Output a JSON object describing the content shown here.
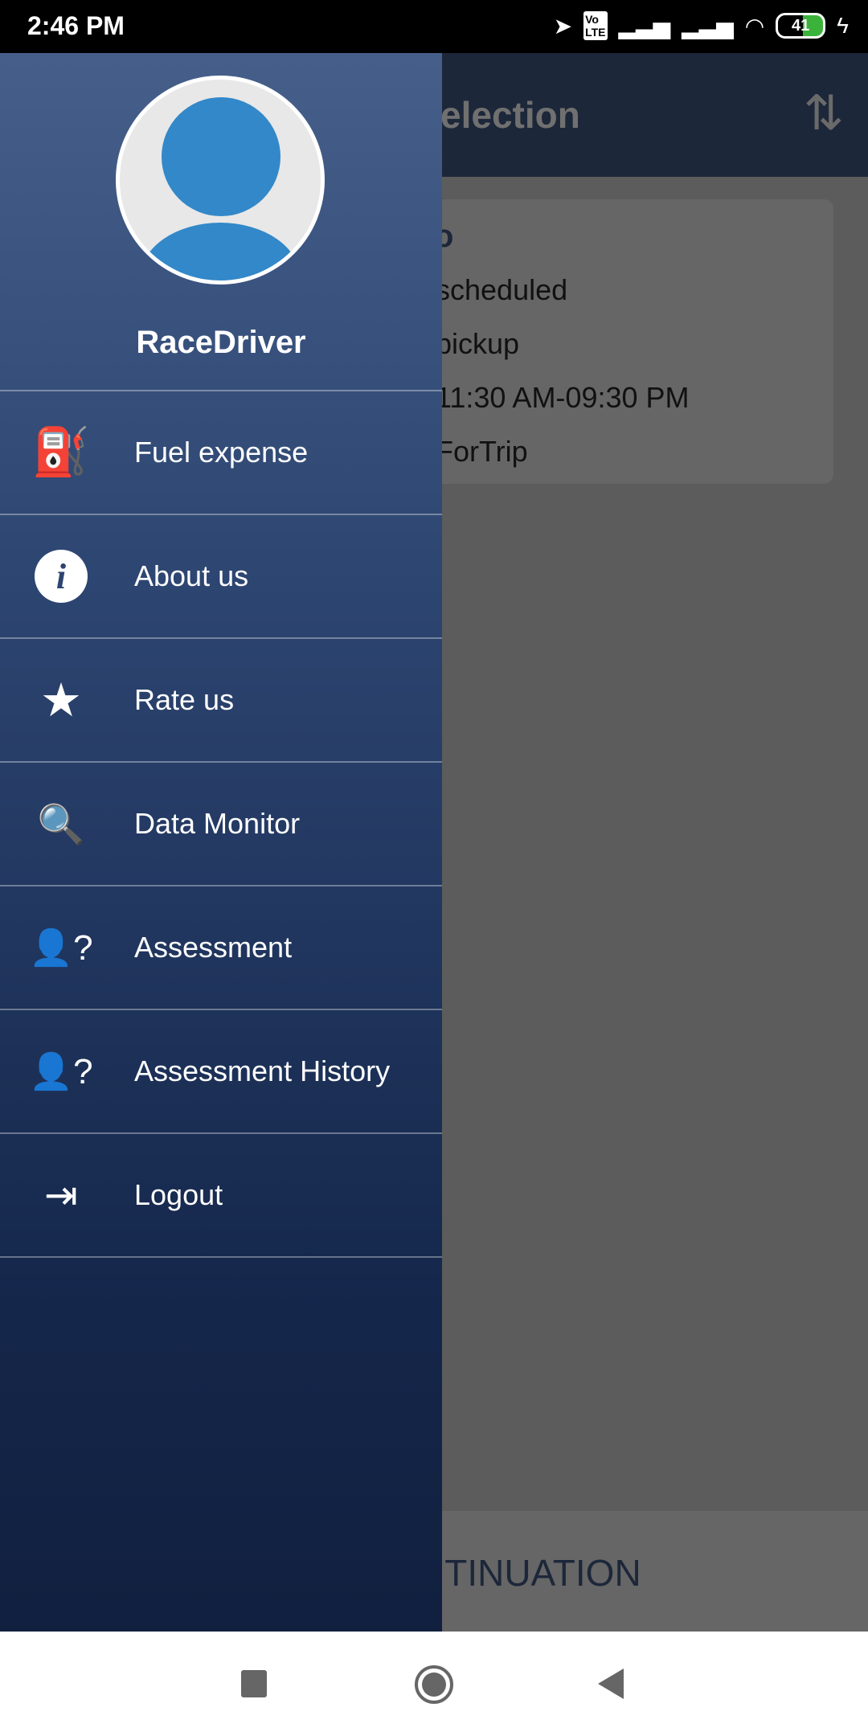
{
  "status_bar": {
    "time": "2:46 PM",
    "battery": "41",
    "icons": [
      "location-arrow-icon",
      "volte-icon",
      "signal-icon",
      "signal-icon",
      "wifi-icon",
      "battery-icon",
      "charging-icon"
    ]
  },
  "app_bar": {
    "title": "election",
    "sync_icon": "sync-icon"
  },
  "card": {
    "heading": "o",
    "lines": [
      "scheduled",
      "pickup",
      "11:30 AM-09:30 PM",
      "ForTrip"
    ]
  },
  "continue_button": {
    "label": "NTINUATION"
  },
  "drawer": {
    "user_name": "RaceDriver",
    "items": [
      {
        "label": "Fuel expense",
        "icon": "fuel-pump-icon"
      },
      {
        "label": "About us",
        "icon": "info-icon"
      },
      {
        "label": "Rate us",
        "icon": "star-icon"
      },
      {
        "label": "Data Monitor",
        "icon": "data-monitor-icon"
      },
      {
        "label": "Assessment",
        "icon": "user-question-icon"
      },
      {
        "label": "Assessment History",
        "icon": "user-question-icon"
      },
      {
        "label": "Logout",
        "icon": "logout-icon"
      }
    ]
  },
  "colors": {
    "drawer_top": "#465f8a",
    "drawer_bottom": "#11203f",
    "avatar_blue": "#3288c9",
    "battery_green": "#3bb33b"
  }
}
